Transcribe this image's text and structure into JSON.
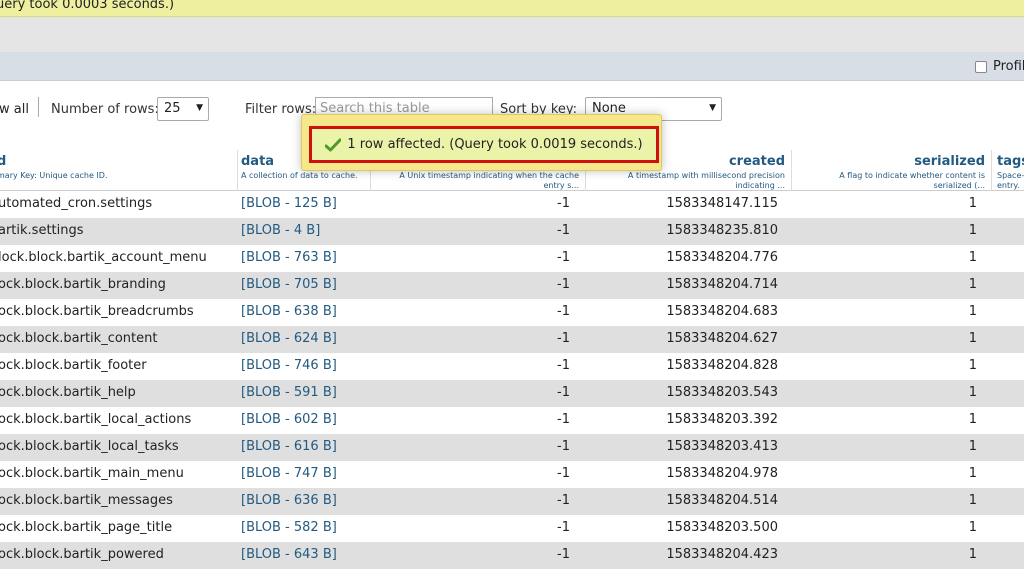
{
  "top_message": "uery took 0.0003 seconds.)",
  "profiling_label": "Profil",
  "nav": {
    "show_all": "w all",
    "rows_label": "Number of rows:",
    "rows_value": "25",
    "filter_label": "Filter rows:",
    "filter_placeholder": "Search this table",
    "sort_label": "Sort by key:",
    "sort_value": "None"
  },
  "popup": {
    "message": "1 row affected. (Query took 0.0019 seconds.)"
  },
  "columns": {
    "cid": {
      "name": "d",
      "desc": "mary Key: Unique cache ID."
    },
    "data": {
      "name": "data",
      "desc": "A collection of data to cache."
    },
    "expire": {
      "name": "",
      "desc": "A Unix timestamp indicating when the cache entry s..."
    },
    "created": {
      "name": "created",
      "desc": "A timestamp with millisecond precision indicating ..."
    },
    "serialized": {
      "name": "serialized",
      "desc": "A flag to indicate whether content is serialized (..."
    },
    "tags": {
      "name": "tags",
      "desc": "Space-entry."
    }
  },
  "rows": [
    {
      "cid": "utomated_cron.settings",
      "data": "[BLOB - 125 B]",
      "expire": "-1",
      "created": "1583348147.115",
      "serialized": "1"
    },
    {
      "cid": "artik.settings",
      "data": "[BLOB - 4 B]",
      "expire": "-1",
      "created": "1583348235.810",
      "serialized": "1"
    },
    {
      "cid": "lock.block.bartik_account_menu",
      "data": "[BLOB - 763 B]",
      "expire": "-1",
      "created": "1583348204.776",
      "serialized": "1"
    },
    {
      "cid": "ock.block.bartik_branding",
      "data": "[BLOB - 705 B]",
      "expire": "-1",
      "created": "1583348204.714",
      "serialized": "1"
    },
    {
      "cid": "ock.block.bartik_breadcrumbs",
      "data": "[BLOB - 638 B]",
      "expire": "-1",
      "created": "1583348204.683",
      "serialized": "1"
    },
    {
      "cid": "ock.block.bartik_content",
      "data": "[BLOB - 624 B]",
      "expire": "-1",
      "created": "1583348204.627",
      "serialized": "1"
    },
    {
      "cid": "ock.block.bartik_footer",
      "data": "[BLOB - 746 B]",
      "expire": "-1",
      "created": "1583348204.828",
      "serialized": "1"
    },
    {
      "cid": "ock.block.bartik_help",
      "data": "[BLOB - 591 B]",
      "expire": "-1",
      "created": "1583348203.543",
      "serialized": "1"
    },
    {
      "cid": "ock.block.bartik_local_actions",
      "data": "[BLOB - 602 B]",
      "expire": "-1",
      "created": "1583348203.392",
      "serialized": "1"
    },
    {
      "cid": "ock.block.bartik_local_tasks",
      "data": "[BLOB - 616 B]",
      "expire": "-1",
      "created": "1583348203.413",
      "serialized": "1"
    },
    {
      "cid": "ock.block.bartik_main_menu",
      "data": "[BLOB - 747 B]",
      "expire": "-1",
      "created": "1583348204.978",
      "serialized": "1"
    },
    {
      "cid": "ock.block.bartik_messages",
      "data": "[BLOB - 636 B]",
      "expire": "-1",
      "created": "1583348204.514",
      "serialized": "1"
    },
    {
      "cid": "ock.block.bartik_page_title",
      "data": "[BLOB - 582 B]",
      "expire": "-1",
      "created": "1583348203.500",
      "serialized": "1"
    },
    {
      "cid": "ock.block.bartik_powered",
      "data": "[BLOB - 643 B]",
      "expire": "-1",
      "created": "1583348204.423",
      "serialized": "1"
    }
  ]
}
